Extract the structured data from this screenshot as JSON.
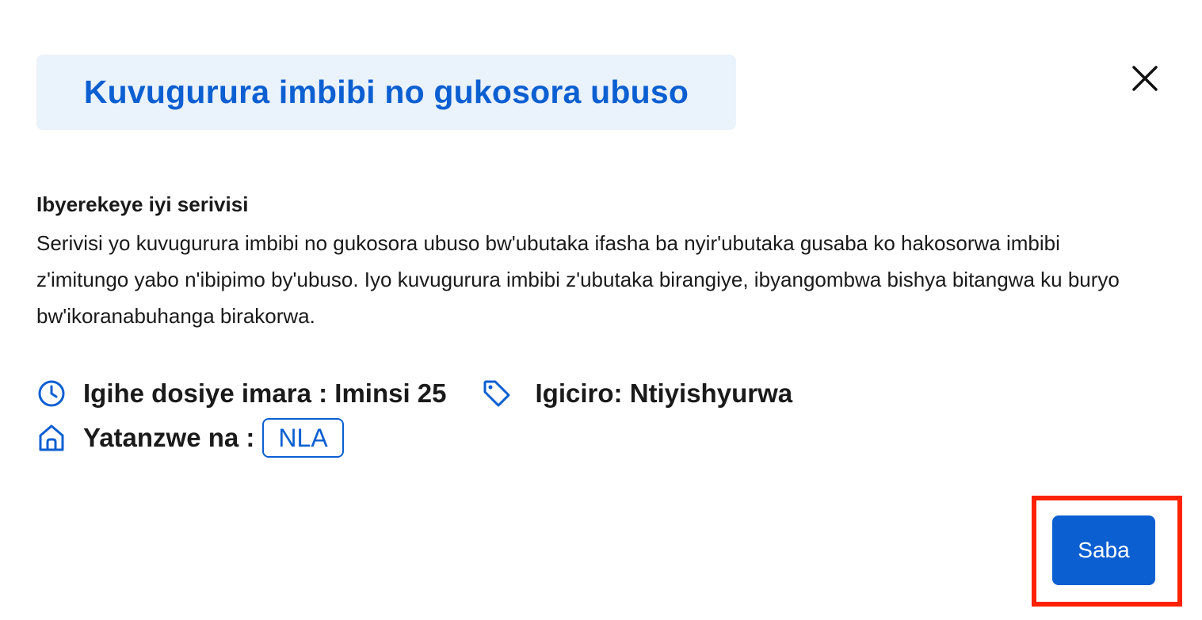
{
  "dialog": {
    "title": "Kuvugurura imbibi no gukosora ubuso",
    "close_icon": "close-icon"
  },
  "about": {
    "heading": "Ibyerekeye iyi serivisi",
    "body": "Serivisi yo kuvugurura imbibi no gukosora ubuso bw'ubutaka ifasha ba nyir'ubutaka gusaba ko hakosorwa imbibi z'imitungo yabo n'ibipimo by'ubuso. Iyo kuvugurura imbibi z'ubutaka birangiye, ibyangombwa bishya bitangwa ku buryo bw'ikoranabuhanga birakorwa."
  },
  "meta": {
    "duration_label": "Igihe dosiye imara : Iminsi 25",
    "duration_icon": "clock-icon",
    "price_label": "Igiciro: Ntiyishyurwa",
    "price_icon": "tag-icon",
    "provider_label": "Yatanzwe na :",
    "provider_icon": "home-icon",
    "provider_badge": "NLA"
  },
  "actions": {
    "apply_label": "Saba"
  },
  "colors": {
    "accent": "#0b5fd1",
    "title_bg": "#eaf2fc",
    "highlight": "#ff2200"
  }
}
